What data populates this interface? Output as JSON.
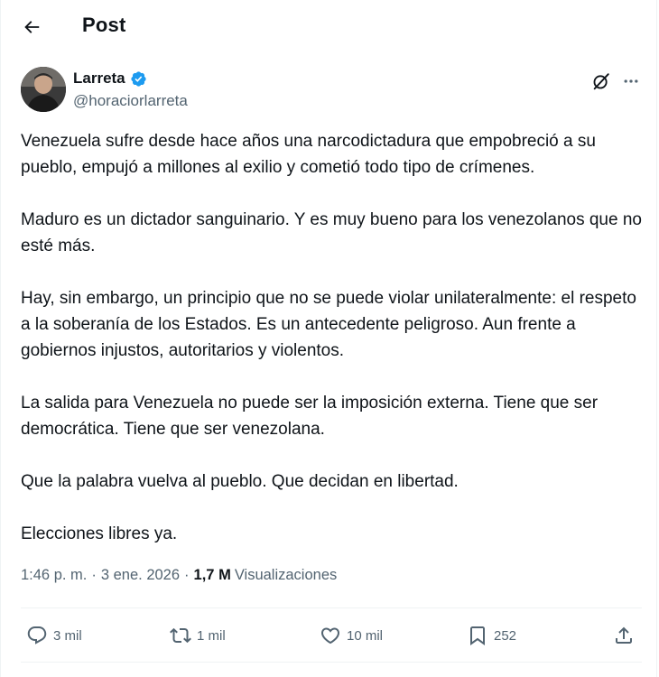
{
  "header": {
    "title": "Post"
  },
  "author": {
    "name": "Larreta",
    "handle": "@horaciorlarreta",
    "verified": true
  },
  "tweet": {
    "paragraphs": [
      "Venezuela sufre desde hace años una narcodictadura que empobreció a su pueblo, empujó a millones al exilio y cometió todo tipo de crímenes.",
      "Maduro es un dictador sanguinario. Y es muy bueno para los venezolanos que no esté más.",
      "Hay, sin embargo, un principio que no se puede violar unilateralmente: el respeto a la soberanía de los Estados. Es un antecedente peligroso. Aun frente a gobiernos injustos, autoritarios y violentos.",
      "La salida para Venezuela no puede ser la imposición externa. Tiene que ser democrática. Tiene que ser venezolana.",
      "Que la palabra vuelva al pueblo. Que decidan en libertad.",
      "Elecciones libres ya."
    ]
  },
  "meta": {
    "time": "1:46 p. m.",
    "separator": "·",
    "date": "3 ene. 2026",
    "views_count": "1,7 M",
    "views_label": "Visualizaciones"
  },
  "actions": {
    "replies": "3 mil",
    "reposts": "1 mil",
    "likes": "10 mil",
    "bookmarks": "252"
  },
  "colors": {
    "text": "#0f1419",
    "secondary": "#536471",
    "verified_badge": "#1d9bf0",
    "divider": "#eff3f4"
  },
  "icons": [
    "back-arrow-icon",
    "verified-badge-icon",
    "grok-icon",
    "more-dots-icon",
    "reply-icon",
    "repost-icon",
    "like-icon",
    "bookmark-icon",
    "share-icon"
  ]
}
